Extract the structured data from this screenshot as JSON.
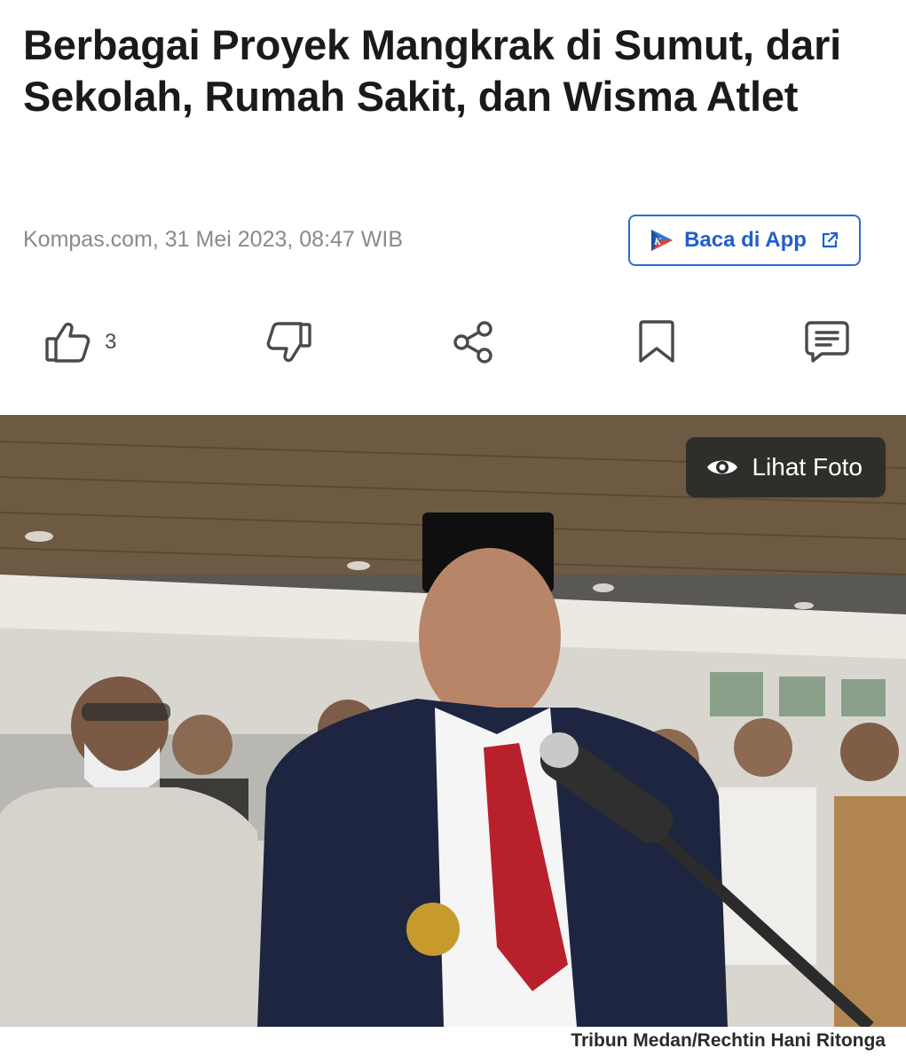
{
  "article": {
    "title": "Berbagai Proyek Mangkrak di Sumut, dari Sekolah, Rumah Sakit, dan Wisma Atlet",
    "meta": "Kompas.com, 31 Mei 2023, 08:47 WIB"
  },
  "app_button": {
    "label": "Baca di App",
    "icon": "kompas-app-icon",
    "trailing_icon": "external-link-icon"
  },
  "actions": {
    "like_count": "3",
    "icons": [
      "thumbs-up-icon",
      "thumbs-down-icon",
      "share-icon",
      "bookmark-icon",
      "comment-icon"
    ]
  },
  "photo": {
    "view_label": "Lihat Foto",
    "caption": "Tribun Medan/Rechtin Hani Ritonga"
  },
  "colors": {
    "accent": "#2b6bd6",
    "title": "#1a1a1a",
    "meta": "#8a8a8a"
  }
}
